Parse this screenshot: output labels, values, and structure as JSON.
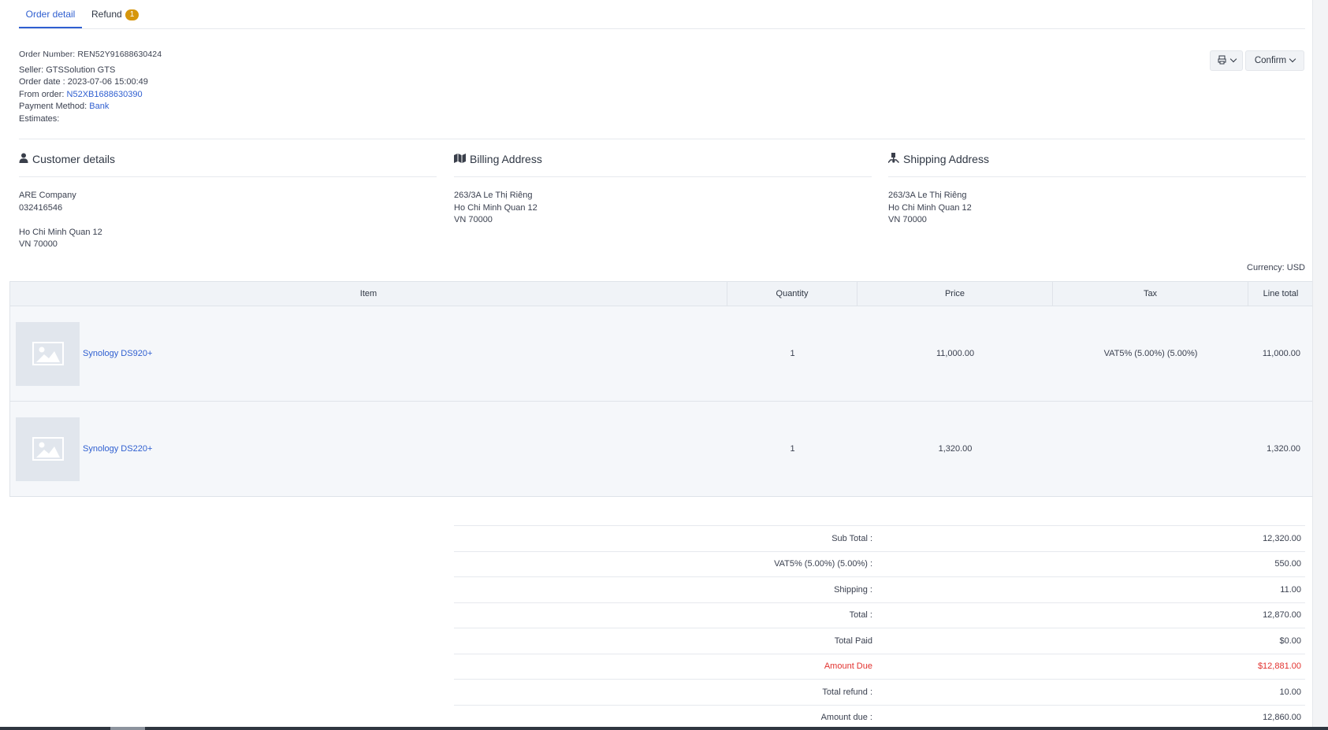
{
  "tabs": {
    "order_detail": "Order detail",
    "refund": "Refund",
    "refund_count": "1"
  },
  "order": {
    "number_label": "Order Number:",
    "number": "REN52Y91688630424",
    "seller_label": "Seller:",
    "seller": "GTSSolution GTS",
    "date_label": "Order date :",
    "date": "2023-07-06 15:00:49",
    "from_label": "From order:",
    "from_order": "N52XB1688630390",
    "payment_label": "Payment Method:",
    "payment_method": "Bank",
    "estimates_label": "Estimates:"
  },
  "actions": {
    "print_icon": "print-icon",
    "confirm_label": "Confirm"
  },
  "customer": {
    "title": "Customer details",
    "icon": "user-icon",
    "name": "ARE Company",
    "phone": "032416546",
    "city": "Ho Chi Minh Quan 12",
    "country": "VN 70000"
  },
  "billing": {
    "title": "Billing Address",
    "icon": "map-icon",
    "street": "263/3A Le Thị Riêng",
    "city": "Ho Chi Minh Quan 12",
    "country": "VN 70000"
  },
  "shipping": {
    "title": "Shipping Address",
    "icon": "dolly-icon",
    "street": "263/3A Le Thị Riêng",
    "city": "Ho Chi Minh Quan 12",
    "country": "VN 70000"
  },
  "currency": "Currency: USD",
  "table": {
    "headers": {
      "item": "Item",
      "quantity": "Quantity",
      "price": "Price",
      "tax": "Tax",
      "line_total": "Line total"
    },
    "rows": [
      {
        "name": "Synology DS920+",
        "quantity": "1",
        "price": "11,000.00",
        "tax": "VAT5% (5.00%) (5.00%)",
        "line_total": "11,000.00"
      },
      {
        "name": "Synology DS220+",
        "quantity": "1",
        "price": "1,320.00",
        "tax": "",
        "line_total": "1,320.00"
      }
    ]
  },
  "totals": [
    {
      "label": "Sub Total :",
      "value": "12,320.00"
    },
    {
      "label": "VAT5% (5.00%) (5.00%) :",
      "value": "550.00"
    },
    {
      "label": "Shipping :",
      "value": "11.00"
    },
    {
      "label": "Total :",
      "value": "12,870.00"
    },
    {
      "label": "Total Paid",
      "value": "$0.00"
    },
    {
      "label": "Amount Due",
      "value": "$12,881.00"
    },
    {
      "label": "Total refund :",
      "value": "10.00"
    },
    {
      "label": "Amount due :",
      "value": "12,860.00"
    }
  ],
  "colors": {
    "accent": "#2f5fd0",
    "badge": "#d6960b",
    "due": "#e2322f"
  }
}
